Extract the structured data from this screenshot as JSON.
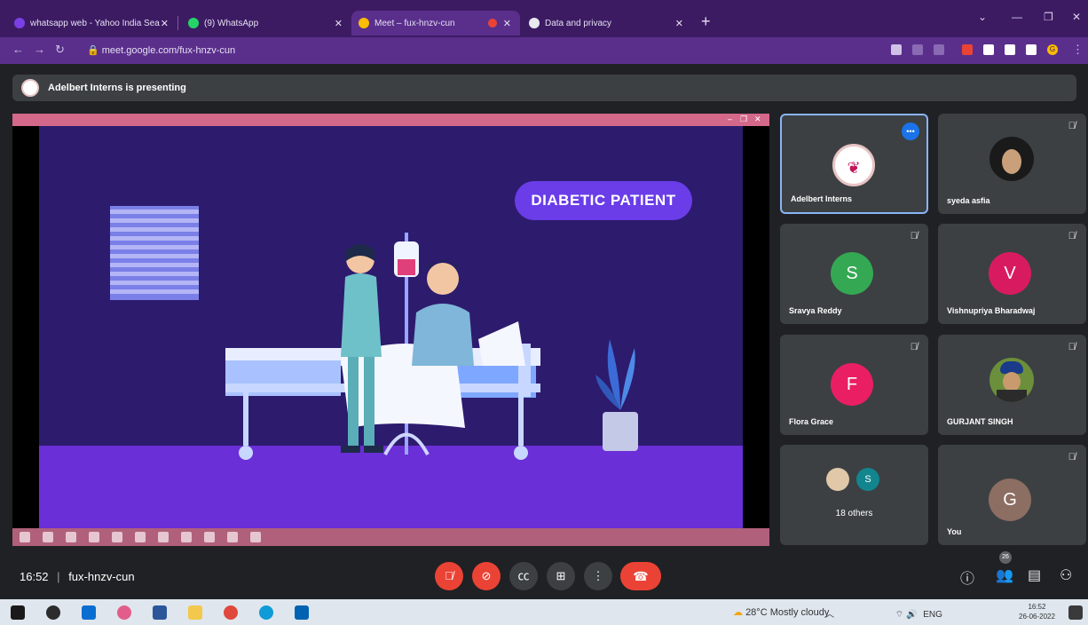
{
  "browser": {
    "tabs": [
      {
        "title": "whatsapp web - Yahoo India Sea",
        "active": false
      },
      {
        "title": "(9) WhatsApp",
        "active": false
      },
      {
        "title": "Meet – fux-hnzv-cun",
        "active": true
      },
      {
        "title": "Data and privacy",
        "active": false
      }
    ],
    "url": "meet.google.com/fux-hnzv-cun",
    "profile_initial": "G",
    "colors": {
      "frame": "#3c1b63",
      "toolbar": "#5a2f8c"
    }
  },
  "meet": {
    "presenting_banner": "Adelbert Interns is presenting",
    "slide": {
      "heading": "DIABETIC PATIENT"
    },
    "participants": [
      {
        "name": "Adelbert Interns",
        "type": "logo",
        "speaking": true
      },
      {
        "name": "syeda asfia",
        "type": "photo",
        "muted": true
      },
      {
        "name": "Sravya Reddy",
        "initial": "S",
        "color": "#34a853",
        "muted": true
      },
      {
        "name": "Vishnupriya Bharadwaj",
        "initial": "V",
        "color": "#d81b60",
        "muted": true
      },
      {
        "name": "Flora Grace",
        "initial": "F",
        "color": "#e91e63",
        "muted": true
      },
      {
        "name": "GURJANT SINGH",
        "type": "photo",
        "muted": true
      },
      {
        "name": "18 others",
        "type": "others",
        "extra_initial": "S"
      },
      {
        "name": "You",
        "initial": "G",
        "color": "#8d6e63",
        "muted": true
      }
    ],
    "controls": {
      "time": "16:52",
      "separator": "|",
      "meeting_code": "fux-hnzv-cun",
      "people_count": "26"
    }
  },
  "taskbar": {
    "weather": "28°C  Mostly cloudy",
    "language": "ENG",
    "time": "16:52",
    "date": "26-06-2022"
  }
}
